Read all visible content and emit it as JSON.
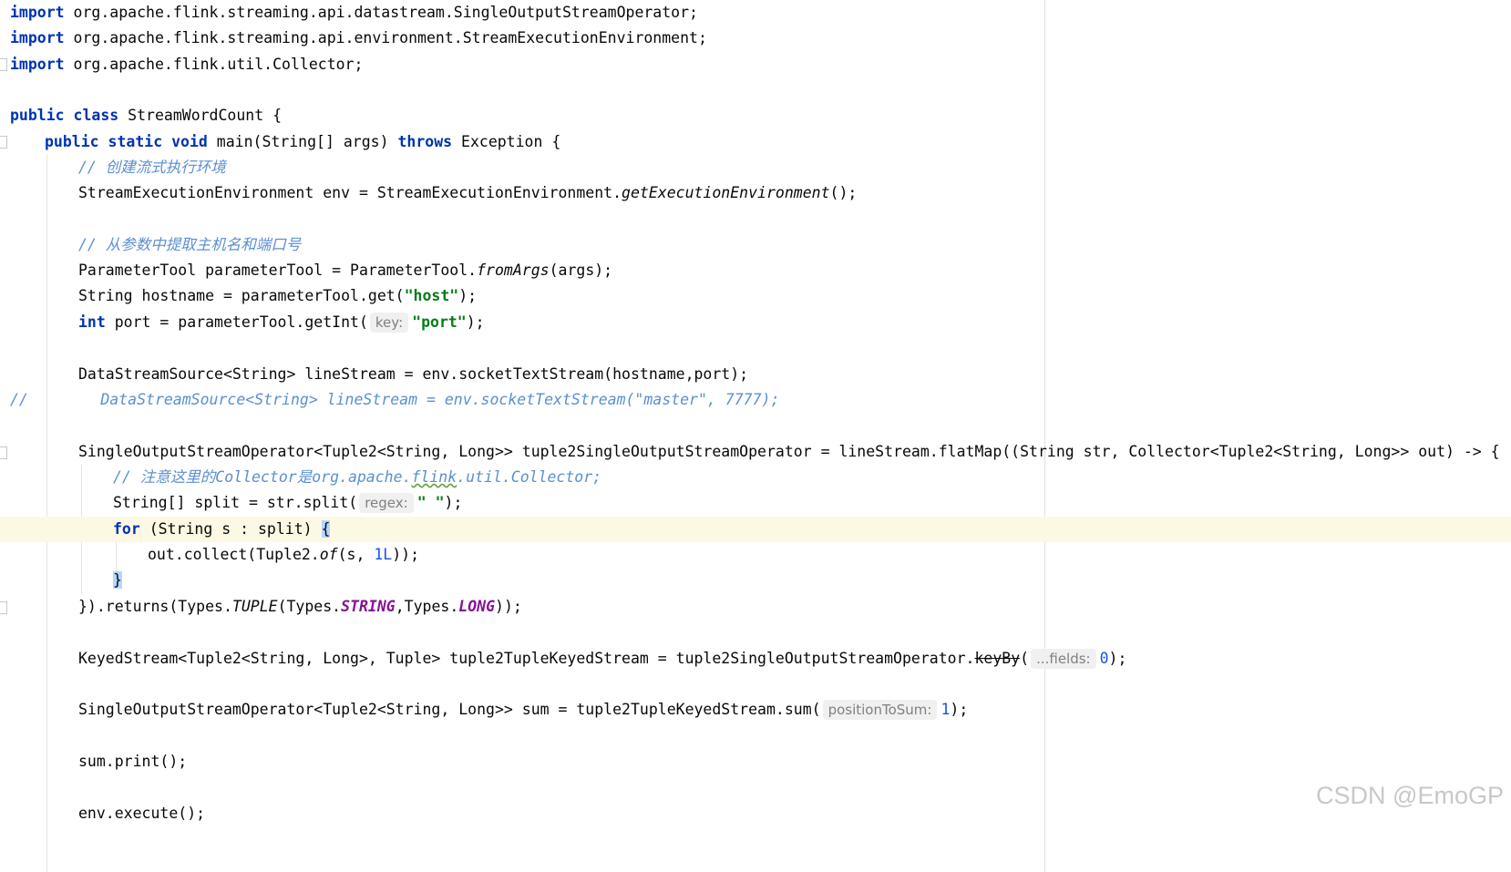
{
  "editor": {
    "language": "java",
    "current_line": 21,
    "lines": [
      {
        "text": "import org.apache.flink.streaming.api.datastream.SingleOutputStreamOperator;"
      },
      {
        "text": "import org.apache.flink.streaming.api.environment.StreamExecutionEnvironment;"
      },
      {
        "text": "import org.apache.flink.util.Collector;"
      },
      {
        "text": ""
      },
      {
        "text": "public class StreamWordCount {"
      },
      {
        "text": "    public static void main(String[] args) throws Exception {"
      },
      {
        "text": "        // 创建流式执行环境"
      },
      {
        "text": "        StreamExecutionEnvironment env = StreamExecutionEnvironment.getExecutionEnvironment();"
      },
      {
        "text": ""
      },
      {
        "text": "        // 从参数中提取主机名和端口号"
      },
      {
        "text": "        ParameterTool parameterTool = ParameterTool.fromArgs(args);"
      },
      {
        "text": "        String hostname = parameterTool.get(\"host\");"
      },
      {
        "text": "        int port = parameterTool.getInt( key: \"port\");"
      },
      {
        "text": ""
      },
      {
        "text": "        DataStreamSource<String> lineStream = env.socketTextStream(hostname,port);"
      },
      {
        "text": "//        DataStreamSource<String> lineStream = env.socketTextStream(\"master\", 7777);"
      },
      {
        "text": ""
      },
      {
        "text": "        SingleOutputStreamOperator<Tuple2<String, Long>> tuple2SingleOutputStreamOperator = lineStream.flatMap((String str, Collector<Tuple2<String, Long>> out) -> {"
      },
      {
        "text": "            // 注意这里的Collector是org.apache.flink.util.Collector;"
      },
      {
        "text": "            String[] split = str.split( regex: \" \");"
      },
      {
        "text": "            for (String s : split) {"
      },
      {
        "text": "                out.collect(Tuple2.of(s, 1L));"
      },
      {
        "text": "            }"
      },
      {
        "text": "        }).returns(Types.TUPLE(Types.STRING,Types.LONG));"
      },
      {
        "text": ""
      },
      {
        "text": "        KeyedStream<Tuple2<String, Long>, Tuple> tuple2TupleKeyedStream = tuple2SingleOutputStreamOperator.keyBy( ...fields: 0);"
      },
      {
        "text": ""
      },
      {
        "text": "        SingleOutputStreamOperator<Tuple2<String, Long>> sum = tuple2TupleKeyedStream.sum( positionToSum: 1);"
      },
      {
        "text": ""
      },
      {
        "text": "        sum.print();"
      },
      {
        "text": ""
      },
      {
        "text": "        env.execute();"
      }
    ]
  },
  "tokens": {
    "import": "import",
    "public": "public",
    "class": "class",
    "static": "static",
    "void": "void",
    "throws": "throws",
    "int": "int",
    "for": "for",
    "imp1": " org.apache.flink.streaming.api.datastream.SingleOutputStreamOperator;",
    "imp2": " org.apache.flink.streaming.api.environment.StreamExecutionEnvironment;",
    "imp3": " org.apache.flink.util.Collector;",
    "class_name": " StreamWordCount {",
    "main_sig": " main(String[] args) ",
    "main_tail": " Exception {",
    "cmt1": "// 创建流式执行环境",
    "env_decl": "StreamExecutionEnvironment env = StreamExecutionEnvironment.",
    "env_method": "getExecutionEnvironment",
    "env_tail": "();",
    "cmt2": "// 从参数中提取主机名和端口号",
    "pt_decl": "ParameterTool parameterTool = ParameterTool.",
    "pt_method": "fromArgs",
    "pt_tail": "(args);",
    "host_decl": "String hostname = parameterTool.get(",
    "host_str": "\"host\"",
    "host_tail": ");",
    "port_decl": " port = parameterTool.getInt(",
    "hint_key": "key:",
    "port_str": "\"port\"",
    "port_tail": ");",
    "ls_decl": "DataStreamSource<String> lineStream = env.socketTextStream(hostname,port);",
    "ls_comment": "//        DataStreamSource<String> lineStream = env.socketTextStream(\"master\", 7777);",
    "fm_decl": "SingleOutputStreamOperator<Tuple2<String, Long>> tuple2SingleOutputStreamOperator = lineStream.flatMap((String str, Collector<Tuple2<String, Long>> out) -> {",
    "cmt3_a": "// 注意这里的Collector是org.apache.",
    "cmt3_b": "flink",
    "cmt3_c": ".util.Collector;",
    "split_decl": "String[] split = str.split(",
    "hint_regex": "regex:",
    "split_str": "\" \"",
    "split_tail": ");",
    "for_body": " (String s : split) ",
    "brace_open": "{",
    "collect_a": "out.collect(Tuple2.",
    "collect_of": "of",
    "collect_b": "(s, ",
    "collect_num": "1L",
    "collect_c": "));",
    "brace_close": "}",
    "ret_a": "}).returns(Types.",
    "ret_tuple": "TUPLE",
    "ret_b": "(Types.",
    "ret_string": "STRING",
    "ret_c": ",Types.",
    "ret_long": "LONG",
    "ret_d": "));",
    "ks_decl": "KeyedStream<Tuple2<String, Long>, Tuple> tuple2TupleKeyedStream = tuple2SingleOutputStreamOperator.",
    "ks_method": "keyBy",
    "ks_paren": "(",
    "hint_fields": "...fields:",
    "ks_num": "0",
    "ks_tail": ");",
    "sum_decl": "SingleOutputStreamOperator<Tuple2<String, Long>> sum = tuple2TupleKeyedStream.sum(",
    "hint_pos": "positionToSum:",
    "sum_num": "1",
    "sum_tail": ");",
    "print": "sum.print();",
    "exec": "env.execute();"
  },
  "watermark": "CSDN @EmoGP"
}
